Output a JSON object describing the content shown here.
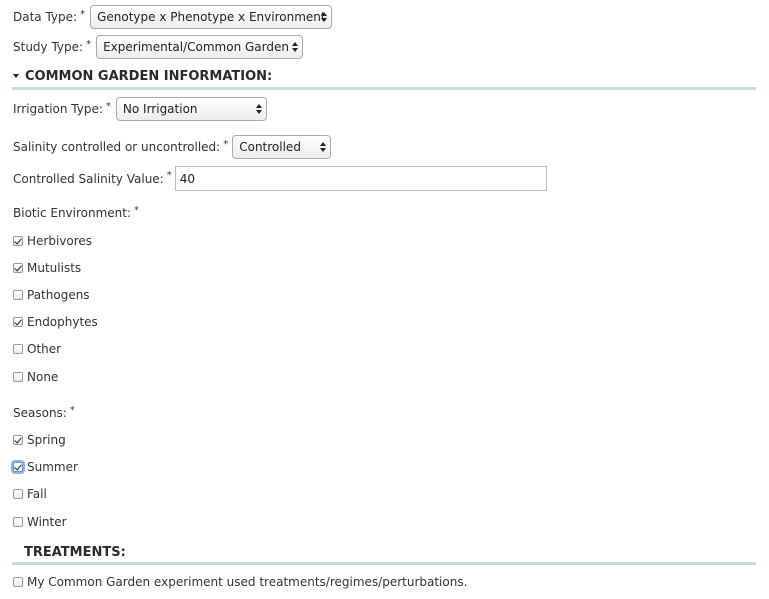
{
  "form": {
    "data_type": {
      "label": "Data Type:",
      "required": "*",
      "value": "Genotype x Phenotype x Environment"
    },
    "study_type": {
      "label": "Study Type:",
      "required": "*",
      "value": "Experimental/Common Garden"
    }
  },
  "common_garden": {
    "title": "COMMON GARDEN INFORMATION:",
    "irrigation": {
      "label": "Irrigation Type:",
      "required": "*",
      "value": "No Irrigation"
    },
    "salinity": {
      "label": "Salinity controlled or uncontrolled:",
      "required": "*",
      "value": "Controlled"
    },
    "salinity_value": {
      "label": "Controlled Salinity Value:",
      "required": "*",
      "value": "40"
    },
    "biotic": {
      "label": "Biotic Environment:",
      "required": "*",
      "options": [
        {
          "label": "Herbivores",
          "checked": true
        },
        {
          "label": "Mutulists",
          "checked": true
        },
        {
          "label": "Pathogens",
          "checked": false
        },
        {
          "label": "Endophytes",
          "checked": true
        },
        {
          "label": "Other",
          "checked": false
        },
        {
          "label": "None",
          "checked": false
        }
      ]
    },
    "seasons": {
      "label": "Seasons:",
      "required": "*",
      "options": [
        {
          "label": "Spring",
          "checked": true
        },
        {
          "label": "Summer",
          "checked": true,
          "focused": true
        },
        {
          "label": "Fall",
          "checked": false
        },
        {
          "label": "Winter",
          "checked": false
        }
      ]
    }
  },
  "treatments": {
    "title": "TREATMENTS:",
    "option": {
      "label": "My Common Garden experiment used treatments/regimes/perturbations.",
      "checked": false
    }
  },
  "colors": {
    "section_rule": "#c8dcd6",
    "focus_ring": "#8fb4e8"
  }
}
